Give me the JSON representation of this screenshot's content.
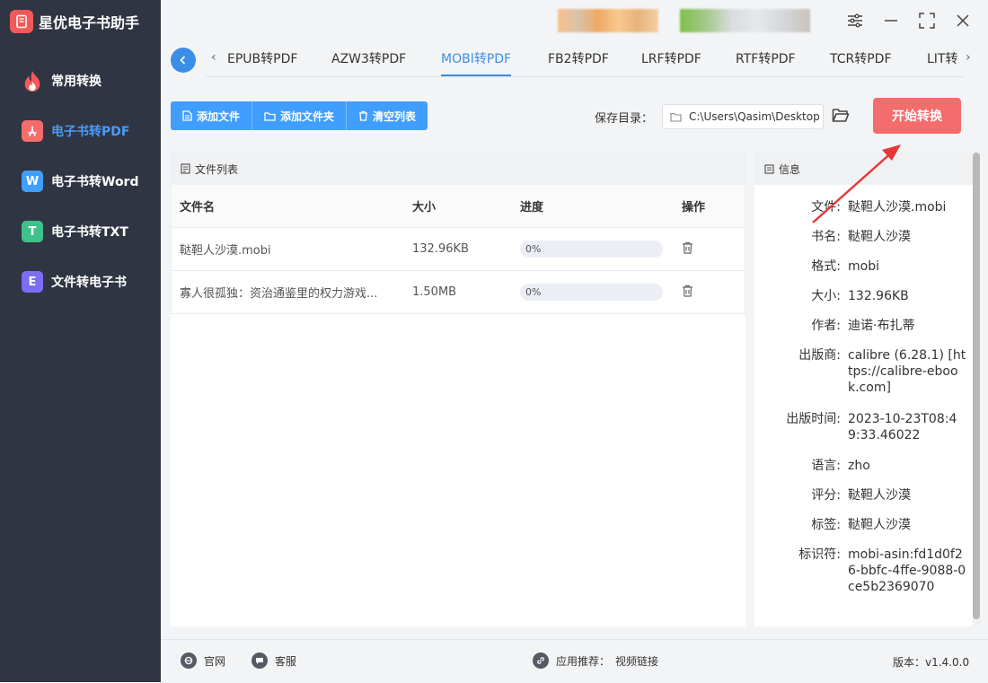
{
  "app": {
    "title": "星优电子书助手"
  },
  "sidebar": {
    "items": [
      {
        "label": "常用转换",
        "icon": "flame-icon",
        "color": "#f25a5a"
      },
      {
        "label": "电子书转PDF",
        "icon": "pdf-icon",
        "color": "#f56c6c",
        "active": true
      },
      {
        "label": "电子书转Word",
        "icon": "word-icon",
        "glyph": "W",
        "color": "#409eff"
      },
      {
        "label": "电子书转TXT",
        "icon": "txt-icon",
        "glyph": "T",
        "color": "#3fc28a"
      },
      {
        "label": "文件转电子书",
        "icon": "ebook-icon",
        "glyph": "E",
        "color": "#7b6ef6"
      }
    ]
  },
  "tabs": [
    {
      "label": "EPUB转PDF"
    },
    {
      "label": "AZW3转PDF"
    },
    {
      "label": "MOBI转PDF",
      "active": true
    },
    {
      "label": "FB2转PDF"
    },
    {
      "label": "LRF转PDF"
    },
    {
      "label": "RTF转PDF"
    },
    {
      "label": "TCR转PDF"
    },
    {
      "label": "LIT转"
    }
  ],
  "toolbar": {
    "add_file": "添加文件",
    "add_folder": "添加文件夹",
    "clear_list": "清空列表",
    "save_dir_label": "保存目录：",
    "save_dir_path": "C:\\Users\\Qasim\\Desktop",
    "start": "开始转换"
  },
  "file_list": {
    "title": "文件列表",
    "columns": {
      "name": "文件名",
      "size": "大小",
      "progress": "进度",
      "action": "操作"
    },
    "rows": [
      {
        "name": "鞑靼人沙漠.mobi",
        "size": "132.96KB",
        "progress": 0,
        "progress_text": "0%"
      },
      {
        "name": "寡人很孤独：资治通鉴里的权力游戏...",
        "size": "1.50MB",
        "progress": 0,
        "progress_text": "0%"
      }
    ]
  },
  "info": {
    "title": "信息",
    "fields": [
      {
        "key": "文件:",
        "value": "鞑靼人沙漠.mobi"
      },
      {
        "key": "书名:",
        "value": "鞑靼人沙漠"
      },
      {
        "key": "格式:",
        "value": "mobi"
      },
      {
        "key": "大小:",
        "value": "132.96KB"
      },
      {
        "key": "作者:",
        "value": "迪诺·布扎蒂"
      },
      {
        "key": "出版商:",
        "value": "calibre (6.28.1) [https://calibre-ebook.com]"
      },
      {
        "key": "出版时间:",
        "value": "2023-10-23T08:49:33.46022"
      },
      {
        "key": "语言:",
        "value": "zho"
      },
      {
        "key": "评分:",
        "value": "鞑靼人沙漠"
      },
      {
        "key": "标签:",
        "value": "鞑靼人沙漠"
      },
      {
        "key": "标识符:",
        "value": "mobi-asin:fd1d0f26-bbfc-4ffe-9088-0ce5b2369070"
      }
    ]
  },
  "footer": {
    "website": "官网",
    "support": "客服",
    "recommend_label": "应用推荐：",
    "recommend_value": "视频链接",
    "version": "版本：v1.4.0.0"
  },
  "colors": {
    "accent": "#409eff",
    "danger": "#f56c6c",
    "sidebar_bg": "#2f3542"
  }
}
